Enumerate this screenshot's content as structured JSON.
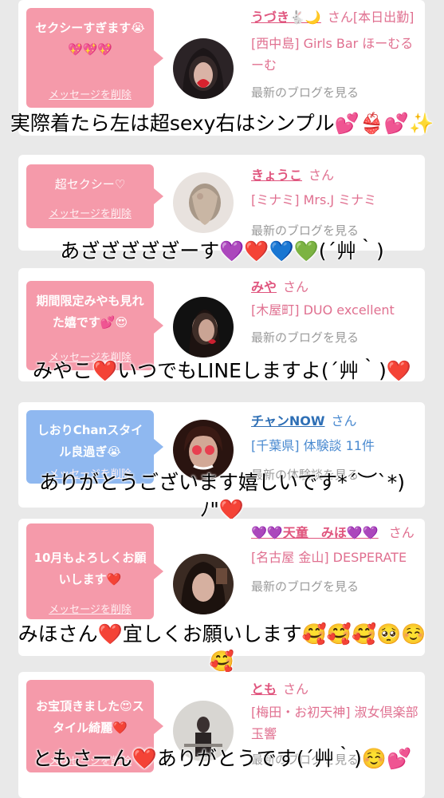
{
  "cards": [
    {
      "message": "セクシーすぎます😭💖💖💖",
      "delete_label": "メッセージを削除",
      "name": "うづき🐇🌙",
      "san": "さん",
      "status": "[本日出勤]",
      "shop": "[西中島] Girls Bar ほーむるーむ",
      "blog": "最新のブログを見る",
      "overlay": "実際着たら左は超sexy右はシンプル💕👙💕✨"
    },
    {
      "message": "超セクシー♡",
      "delete_label": "メッセージを削除",
      "name": "きょうこ",
      "san": "さん",
      "shop": "[ミナミ] Mrs.J ミナミ",
      "blog": "最新のブログを見る",
      "overlay": "あざざざざざーす💜❤️💙💚(´艸｀)"
    },
    {
      "message": "期間限定みやも見れた嬉です💕😍",
      "delete_label": "メッセージを削除",
      "name": "みや",
      "san": "さん",
      "shop": "[木屋町] DUO excellent",
      "blog": "最新のブログを見る",
      "overlay": "みやこ❤️いつでもLINEしますよ(´艸｀)❤️"
    },
    {
      "message": "しおりChanスタイル良過ぎ😭",
      "delete_label": "メッセージを削除",
      "name": "チャンNOW",
      "san": "さん",
      "shop": "[千葉県] 体験談 11件",
      "blog": "最新の体験談を見る",
      "overlay": "ありがとうございます嬉しいです*´︶`*)ﾉ\"❤️"
    },
    {
      "message": "10月もよろしくお願いします❤️",
      "delete_label": "メッセージを削除",
      "name": "💜💜天童　みほ💜💜",
      "san": "さん",
      "shop": "[名古屋 金山] DESPERATE",
      "blog": "最新のブログを見る",
      "overlay": "みほさん❤️宜しくお願いします🥰🥰🥰🥺☺️🥰"
    },
    {
      "message": "お宝頂きました😍スタイル綺麗❤️",
      "delete_label": "メッセージを削除",
      "name": "とも",
      "san": "さん",
      "shop": "[梅田・お初天神] 淑女倶楽部 玉響",
      "blog": "最新のブログを見る",
      "overlay": "ともさーん❤️ありがとうです(´艸｀)☺️💕"
    }
  ],
  "colors": {
    "pink_bubble": "#f59aaa",
    "blue_bubble": "#8fb8f0",
    "name_pink": "#e0557e",
    "name_blue": "#2e6fb5",
    "background": "#e9e9e9"
  }
}
